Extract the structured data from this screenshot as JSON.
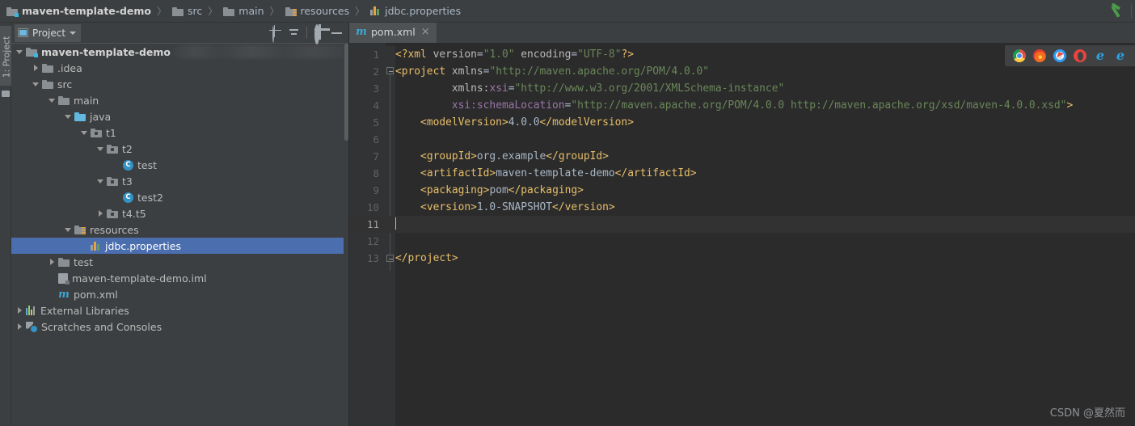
{
  "breadcrumb": {
    "name": "breadcrumb",
    "items": [
      {
        "label": "maven-template-demo",
        "icon": "module-folder-icon",
        "root": true
      },
      {
        "label": "src",
        "icon": "folder-icon"
      },
      {
        "label": "main",
        "icon": "folder-icon"
      },
      {
        "label": "resources",
        "icon": "resources-folder-icon"
      },
      {
        "label": "jdbc.properties",
        "icon": "properties-file-icon"
      }
    ],
    "separator": "〉",
    "build_icon": "hammer-build-icon"
  },
  "toolstrip": {
    "label": "1: Project",
    "bottom_icon": "folder-icon"
  },
  "project_panel": {
    "title": "Project",
    "dropdown_icon": "chevron-down-icon",
    "view_icon": "project-view-icon",
    "tools": [
      {
        "name": "select-opened-file-icon",
        "title": "Select Opened File"
      },
      {
        "name": "collapse-all-icon",
        "title": "Collapse All"
      },
      {
        "name": "gear-icon",
        "title": "Settings"
      },
      {
        "name": "minimize-icon",
        "title": "Hide"
      }
    ],
    "tree": [
      {
        "label": "maven-template-demo",
        "icon": "module-folder-icon",
        "indent": 0,
        "arrow": "down",
        "bold": true,
        "selected": false,
        "redacted": true
      },
      {
        "label": ".idea",
        "icon": "folder-icon",
        "indent": 1,
        "arrow": "right",
        "bold": false,
        "selected": false
      },
      {
        "label": "src",
        "icon": "folder-icon",
        "indent": 1,
        "arrow": "down",
        "bold": false,
        "selected": false
      },
      {
        "label": "main",
        "icon": "folder-icon",
        "indent": 2,
        "arrow": "down",
        "bold": false,
        "selected": false
      },
      {
        "label": "java",
        "icon": "source-folder-icon",
        "indent": 3,
        "arrow": "down",
        "bold": false,
        "selected": false
      },
      {
        "label": "t1",
        "icon": "package-icon",
        "indent": 4,
        "arrow": "down",
        "bold": false,
        "selected": false
      },
      {
        "label": "t2",
        "icon": "package-icon",
        "indent": 5,
        "arrow": "down",
        "bold": false,
        "selected": false
      },
      {
        "label": "test",
        "icon": "java-class-icon",
        "indent": 6,
        "arrow": "none",
        "bold": false,
        "selected": false
      },
      {
        "label": "t3",
        "icon": "package-icon",
        "indent": 5,
        "arrow": "down",
        "bold": false,
        "selected": false
      },
      {
        "label": "test2",
        "icon": "java-class-icon",
        "indent": 6,
        "arrow": "none",
        "bold": false,
        "selected": false
      },
      {
        "label": "t4.t5",
        "icon": "package-icon",
        "indent": 5,
        "arrow": "right",
        "bold": false,
        "selected": false
      },
      {
        "label": "resources",
        "icon": "resources-folder-icon",
        "indent": 3,
        "arrow": "down",
        "bold": false,
        "selected": false
      },
      {
        "label": "jdbc.properties",
        "icon": "properties-file-icon",
        "indent": 4,
        "arrow": "none",
        "bold": false,
        "selected": true
      },
      {
        "label": "test",
        "icon": "folder-icon",
        "indent": 2,
        "arrow": "right",
        "bold": false,
        "selected": false
      },
      {
        "label": "maven-template-demo.iml",
        "icon": "iml-file-icon",
        "indent": 2,
        "arrow": "none",
        "bold": false,
        "selected": false
      },
      {
        "label": "pom.xml",
        "icon": "maven-file-icon",
        "indent": 2,
        "arrow": "none",
        "bold": false,
        "selected": false
      },
      {
        "label": "External Libraries",
        "icon": "libraries-icon",
        "indent": 0,
        "arrow": "right",
        "bold": false,
        "selected": false
      },
      {
        "label": "Scratches and Consoles",
        "icon": "scratches-icon",
        "indent": 0,
        "arrow": "right",
        "bold": false,
        "selected": false
      }
    ]
  },
  "editor": {
    "tabs": [
      {
        "label": "pom.xml",
        "icon": "maven-file-icon",
        "close_glyph": "×",
        "active": true
      }
    ],
    "current_line": 11,
    "line_numbers": [
      1,
      2,
      3,
      4,
      5,
      6,
      7,
      8,
      9,
      10,
      11,
      12,
      13
    ],
    "lines": [
      {
        "n": 1,
        "tokens": [
          {
            "t": "punct",
            "v": "<?"
          },
          {
            "t": "tag",
            "v": "xml"
          },
          {
            "t": "txt",
            "v": " "
          },
          {
            "t": "attr",
            "v": "version"
          },
          {
            "t": "txt",
            "v": "="
          },
          {
            "t": "str",
            "v": "\"1.0\""
          },
          {
            "t": "txt",
            "v": " "
          },
          {
            "t": "attr",
            "v": "encoding"
          },
          {
            "t": "txt",
            "v": "="
          },
          {
            "t": "str",
            "v": "\"UTF-8\""
          },
          {
            "t": "punct",
            "v": "?>"
          }
        ]
      },
      {
        "n": 2,
        "tokens": [
          {
            "t": "punct",
            "v": "<"
          },
          {
            "t": "tag",
            "v": "project"
          },
          {
            "t": "txt",
            "v": " "
          },
          {
            "t": "attr",
            "v": "xmlns"
          },
          {
            "t": "txt",
            "v": "="
          },
          {
            "t": "str",
            "v": "\"http://maven.apache.org/POM/4.0.0\""
          }
        ]
      },
      {
        "n": 3,
        "tokens": [
          {
            "t": "txt",
            "v": "         "
          },
          {
            "t": "attr",
            "v": "xmlns:"
          },
          {
            "t": "ns",
            "v": "xsi"
          },
          {
            "t": "txt",
            "v": "="
          },
          {
            "t": "str",
            "v": "\"http://www.w3.org/2001/XMLSchema-instance\""
          }
        ]
      },
      {
        "n": 4,
        "tokens": [
          {
            "t": "txt",
            "v": "         "
          },
          {
            "t": "ns",
            "v": "xsi:"
          },
          {
            "t": "ns",
            "v": "schemaLocation"
          },
          {
            "t": "txt",
            "v": "="
          },
          {
            "t": "str",
            "v": "\"http://maven.apache.org/POM/4.0.0 http://maven.apache.org/xsd/maven-4.0.0.xsd\""
          },
          {
            "t": "punct",
            "v": ">"
          }
        ]
      },
      {
        "n": 5,
        "tokens": [
          {
            "t": "txt",
            "v": "    "
          },
          {
            "t": "punct",
            "v": "<"
          },
          {
            "t": "tag",
            "v": "modelVersion"
          },
          {
            "t": "punct",
            "v": ">"
          },
          {
            "t": "txt",
            "v": "4.0.0"
          },
          {
            "t": "punct",
            "v": "</"
          },
          {
            "t": "tag",
            "v": "modelVersion"
          },
          {
            "t": "punct",
            "v": ">"
          }
        ]
      },
      {
        "n": 6,
        "tokens": []
      },
      {
        "n": 7,
        "tokens": [
          {
            "t": "txt",
            "v": "    "
          },
          {
            "t": "punct",
            "v": "<"
          },
          {
            "t": "tag",
            "v": "groupId"
          },
          {
            "t": "punct",
            "v": ">"
          },
          {
            "t": "txt",
            "v": "org.example"
          },
          {
            "t": "punct",
            "v": "</"
          },
          {
            "t": "tag",
            "v": "groupId"
          },
          {
            "t": "punct",
            "v": ">"
          }
        ]
      },
      {
        "n": 8,
        "tokens": [
          {
            "t": "txt",
            "v": "    "
          },
          {
            "t": "punct",
            "v": "<"
          },
          {
            "t": "tag",
            "v": "artifactId"
          },
          {
            "t": "punct",
            "v": ">"
          },
          {
            "t": "txt",
            "v": "maven-template-demo"
          },
          {
            "t": "punct",
            "v": "</"
          },
          {
            "t": "tag",
            "v": "artifactId"
          },
          {
            "t": "punct",
            "v": ">"
          }
        ]
      },
      {
        "n": 9,
        "tokens": [
          {
            "t": "txt",
            "v": "    "
          },
          {
            "t": "punct",
            "v": "<"
          },
          {
            "t": "tag",
            "v": "packaging"
          },
          {
            "t": "punct",
            "v": ">"
          },
          {
            "t": "txt",
            "v": "pom"
          },
          {
            "t": "punct",
            "v": "</"
          },
          {
            "t": "tag",
            "v": "packaging"
          },
          {
            "t": "punct",
            "v": ">"
          }
        ]
      },
      {
        "n": 10,
        "tokens": [
          {
            "t": "txt",
            "v": "    "
          },
          {
            "t": "punct",
            "v": "<"
          },
          {
            "t": "tag",
            "v": "version"
          },
          {
            "t": "punct",
            "v": ">"
          },
          {
            "t": "txt",
            "v": "1.0-SNAPSHOT"
          },
          {
            "t": "punct",
            "v": "</"
          },
          {
            "t": "tag",
            "v": "version"
          },
          {
            "t": "punct",
            "v": ">"
          }
        ]
      },
      {
        "n": 11,
        "tokens": [],
        "current": true,
        "caret": true
      },
      {
        "n": 12,
        "tokens": []
      },
      {
        "n": 13,
        "tokens": [
          {
            "t": "punct",
            "v": "</"
          },
          {
            "t": "tag",
            "v": "project"
          },
          {
            "t": "punct",
            "v": ">"
          }
        ]
      }
    ],
    "browsers": [
      {
        "name": "chrome-icon",
        "title": "Chrome"
      },
      {
        "name": "firefox-icon",
        "title": "Firefox"
      },
      {
        "name": "safari-icon",
        "title": "Safari"
      },
      {
        "name": "opera-icon",
        "title": "Opera"
      },
      {
        "name": "ie-icon",
        "title": "Internet Explorer"
      },
      {
        "name": "edge-icon",
        "title": "Edge"
      }
    ]
  },
  "watermark": {
    "text": "CSDN @夏然而"
  },
  "colors": {
    "panel_bg": "#3c3f41",
    "editor_bg": "#2b2b2b",
    "gutter_bg": "#313335",
    "selection": "#4b6eaf",
    "tag": "#e8bf6a",
    "string": "#6a8759",
    "namespace": "#9876aa",
    "text": "#a9b7c6"
  }
}
